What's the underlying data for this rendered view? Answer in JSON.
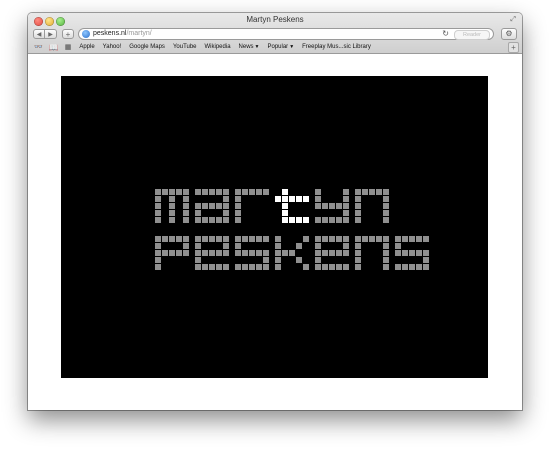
{
  "window": {
    "title": "Martyn Peskens"
  },
  "toolbar": {
    "back": "◀",
    "forward": "▶",
    "add": "+",
    "url_host": "peskens.nl",
    "url_path": "/martyn/",
    "reader": "Reader",
    "reload": "↻",
    "settings": "⚙"
  },
  "bookmarks": [
    {
      "label": "Apple"
    },
    {
      "label": "Yahoo!"
    },
    {
      "label": "Google Maps"
    },
    {
      "label": "YouTube"
    },
    {
      "label": "Wikipedia"
    },
    {
      "label": "News",
      "dropdown": true
    },
    {
      "label": "Popular",
      "dropdown": true
    },
    {
      "label": "Freeplay Mus...sic Library"
    }
  ],
  "logo": {
    "line1": "martyn",
    "line2": "peskens"
  },
  "colors": {
    "panel": "#000000",
    "logo_dim": "#8f8f8f",
    "logo_bright": "#ffffff"
  }
}
